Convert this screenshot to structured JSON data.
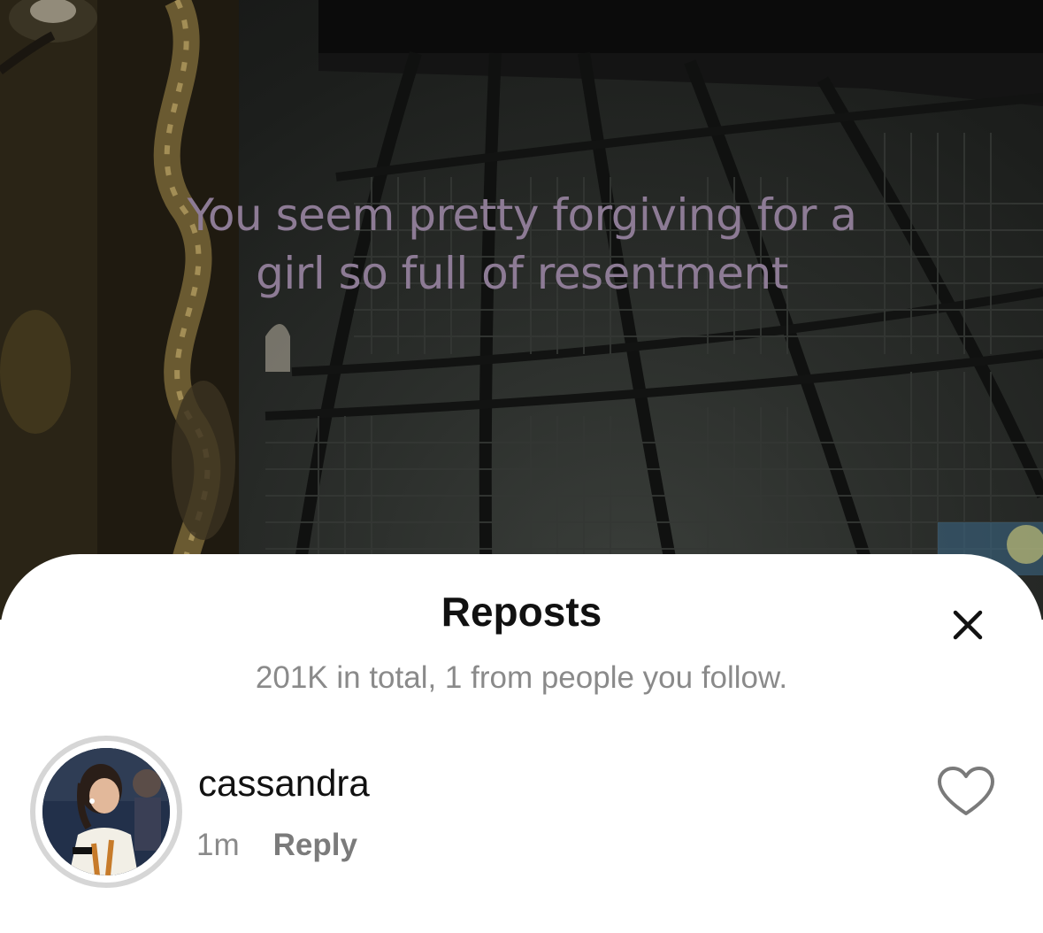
{
  "video": {
    "caption_line1": "You seem pretty forgiving for a",
    "caption_line2": "girl so full of resentment",
    "caption_color": "#8d7b95"
  },
  "sheet": {
    "title": "Reposts",
    "close_icon": "close-icon",
    "subtitle": "201K in total, 1 from people you follow."
  },
  "reposts": [
    {
      "username": "cassandra",
      "time": "1m",
      "reply_label": "Reply",
      "like_icon": "heart-outline-icon"
    }
  ]
}
